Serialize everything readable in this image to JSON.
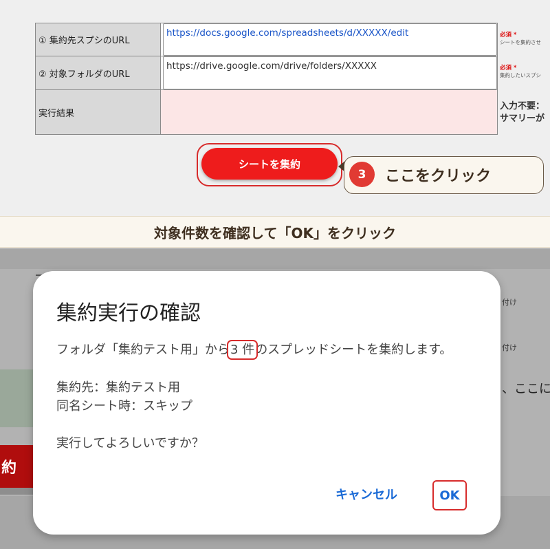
{
  "form": {
    "rows": [
      {
        "label": "① 集約先スプシのURL",
        "value": "https://docs.google.com/spreadsheets/d/XXXXX/edit"
      },
      {
        "label": "② 対象フォルダのURL",
        "value": "https://drive.google.com/drive/folders/XXXXX"
      },
      {
        "label": "実行結果",
        "value": ""
      }
    ],
    "notes": [
      {
        "required": "必須 *",
        "text": "シートを集約させ"
      },
      {
        "required": "必須 *",
        "text": "集約したいスプシ"
      },
      {
        "line1": "入力不要：",
        "line2": "サマリーが"
      }
    ],
    "run_button": "シートを集約"
  },
  "callout": {
    "step": "3",
    "text": "ここをクリック"
  },
  "banner": "対象件数を確認して「OK」をクリック",
  "background": {
    "side1": "付け",
    "side2": "付け",
    "side3": "、ここに",
    "red_button_fragment": "約"
  },
  "dialog": {
    "title": "集約実行の確認",
    "line1_prefix": "フォルダ「集約テスト用」から",
    "count": "3 件",
    "line1_suffix": "のスプレッドシートを集約します。",
    "line2": "集約先：集約テスト用",
    "line3": "同名シート時：スキップ",
    "line4": "実行してよろしいですか？",
    "cancel": "キャンセル",
    "ok": "OK"
  },
  "colors": {
    "accent_red": "#ee1c1c",
    "highlight_red": "#d72b2b",
    "link_blue": "#1a55c8",
    "dialog_button_blue": "#1a6ad6"
  }
}
